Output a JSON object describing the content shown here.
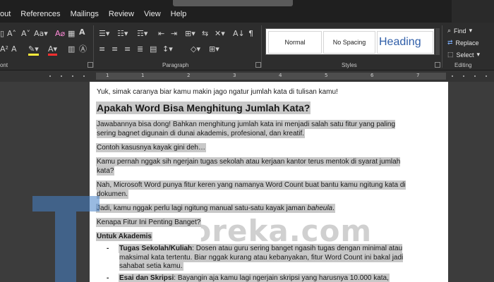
{
  "menu": [
    "out",
    "References",
    "Mailings",
    "Review",
    "View",
    "Help"
  ],
  "ribbon": {
    "font_group_label": "ont",
    "paragraph_group_label": "Paragraph",
    "styles_group_label": "Styles",
    "editing_group_label": "Editing",
    "styles": [
      "Normal",
      "No Spacing",
      "Heading"
    ],
    "editing": {
      "find": "Find",
      "replace": "Replace",
      "select": "Select"
    }
  },
  "ruler": {
    "numbers": [
      "1",
      "1",
      "2",
      "3",
      "4",
      "5",
      "6",
      "7"
    ]
  },
  "document": {
    "intro": "Yuk, simak caranya biar kamu makin jago ngatur jumlah kata di tulisan kamu!",
    "heading": "Apakah Word Bisa Menghitung Jumlah Kata?",
    "p1": "Jawabannya bisa dong! Bahkan menghitung jumlah kata ini menjadi salah satu fitur yang paling sering bagnet digunain di dunai akademis, profesional, dan kreatif.",
    "p2": "Contoh kasusnya kayak gini deh…",
    "p3": "Kamu pernah nggak sih ngerjain tugas sekolah atau kerjaan kantor terus mentok di syarat jumlah kata?",
    "p4": "Nah, Microsoft Word punya fitur keren yang namanya Word Count buat bantu kamu ngitung kata di dokumen.",
    "p5_a": "Jadi, kamu nggak perlu lagi ngitung manual satu-satu kayak jaman ",
    "p5_em": "baheula",
    "p5_b": ".",
    "p6": "Kenapa Fitur Ini Penting Banget?",
    "sub": "Untuk Akademis",
    "b1_title": "Tugas Sekolah/Kuliah",
    "b1_text": ": Dosen atau guru sering banget ngasih tugas dengan minimal atau maksimal kata tertentu. Biar nggak kurang atau kebanyakan, fitur Word Count ini bakal jadi sahabat setia kamu.",
    "b2_title": "Esai dan Skripsi",
    "b2_text": ": Bayangin aja kamu lagi ngerjain skripsi yang harusnya 10.000 kata,"
  },
  "watermark": {
    "text": "teknoreka.com"
  }
}
